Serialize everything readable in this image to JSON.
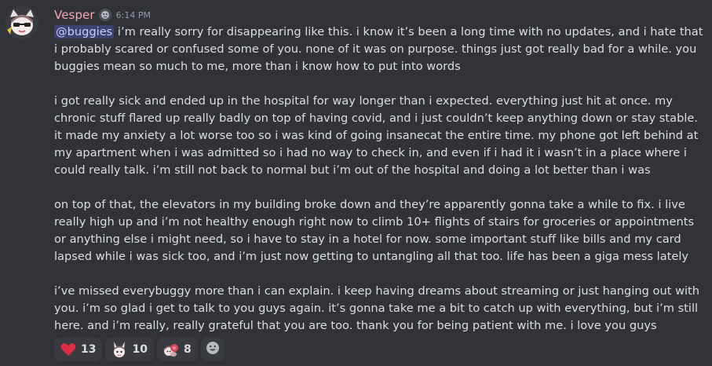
{
  "message": {
    "author": "Vesper",
    "timestamp": "6:14 PM",
    "mention": "@buggies",
    "first_line_rest": " i’m really sorry for disappearing like this. i know it’s been a long time with no updates, and i hate that i probably scared or confused some of you. none of it was on purpose. things just got really bad for a while. you buggies mean so much to me, more than i know how to put into words",
    "paragraph_2": "i got really sick and ended up in the hospital for way longer than i expected. everything just hit at once. my chronic stuff flared up really badly on top of having covid, and i just couldn’t keep anything down or stay stable. it made my anxiety a lot worse too so i was kind of going insanecat the entire time. my phone got left behind at my apartment when i was admitted so i had no way to check in, and even if i had it i wasn’t in a place where i could really talk. i’m still not back to normal but i’m out of the hospital and doing a lot better than i was",
    "paragraph_3": "on top of that, the elevators in my building broke down and they’re apparently gonna take a while to fix. i live really high up and i’m not healthy enough right now to climb 10+ flights of stairs for groceries or appointments or anything else i might need, so i have to stay in a hotel for now. some important stuff like bills and my card lapsed while i was sick too, and i’m just now getting to untangling all that too. life has been a giga mess lately",
    "paragraph_4": "i’ve missed everybuggy more than i can explain. i keep having dreams about streaming or just hanging out with you. i’m so glad i get to talk to you guys again. it’s gonna take me a bit to catch up with everything, but i’m still here. and i’m really, really grateful that you are too. thank you for being patient with me. i love you guys"
  },
  "reactions": [
    {
      "emoji": "heart-emoji",
      "count": "13"
    },
    {
      "emoji": "bunny-custom-emoji",
      "count": "10"
    },
    {
      "emoji": "hug-custom-emoji",
      "count": "8"
    }
  ],
  "colors": {
    "background": "#323339",
    "username": "#f8a5b2",
    "mention_bg": "rgba(88,101,242,0.3)",
    "text": "#dbdee1"
  }
}
